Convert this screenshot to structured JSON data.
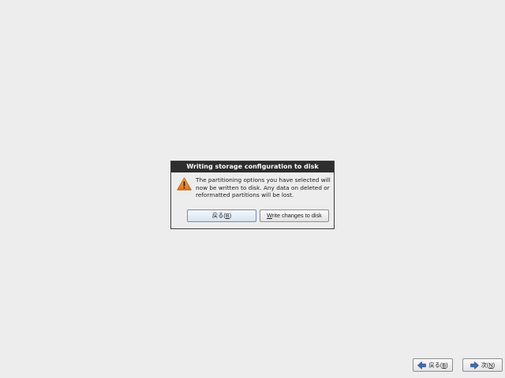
{
  "dialog": {
    "title": "Writing storage configuration to disk",
    "icon": "warning-icon",
    "message": "The partitioning options you have selected will\nnow be written to disk.  Any data on deleted or\nreformatted partitions will be lost.",
    "back_button": {
      "prefix": "戻る(",
      "mnemonic": "B",
      "suffix": ")"
    },
    "write_button": {
      "mnemonic": "W",
      "rest": "rite changes to disk"
    }
  },
  "nav": {
    "back": {
      "prefix": "戻る(",
      "mnemonic": "B",
      "suffix": ")",
      "icon": "arrow-left-icon"
    },
    "next": {
      "prefix": "次(",
      "mnemonic": "N",
      "suffix": ")",
      "icon": "arrow-right-icon"
    }
  },
  "colors": {
    "background": "#ededed",
    "titlebar": "#2e2e2e",
    "arrow_blue": "#3d6cb8",
    "warning_orange": "#f08a1c"
  }
}
